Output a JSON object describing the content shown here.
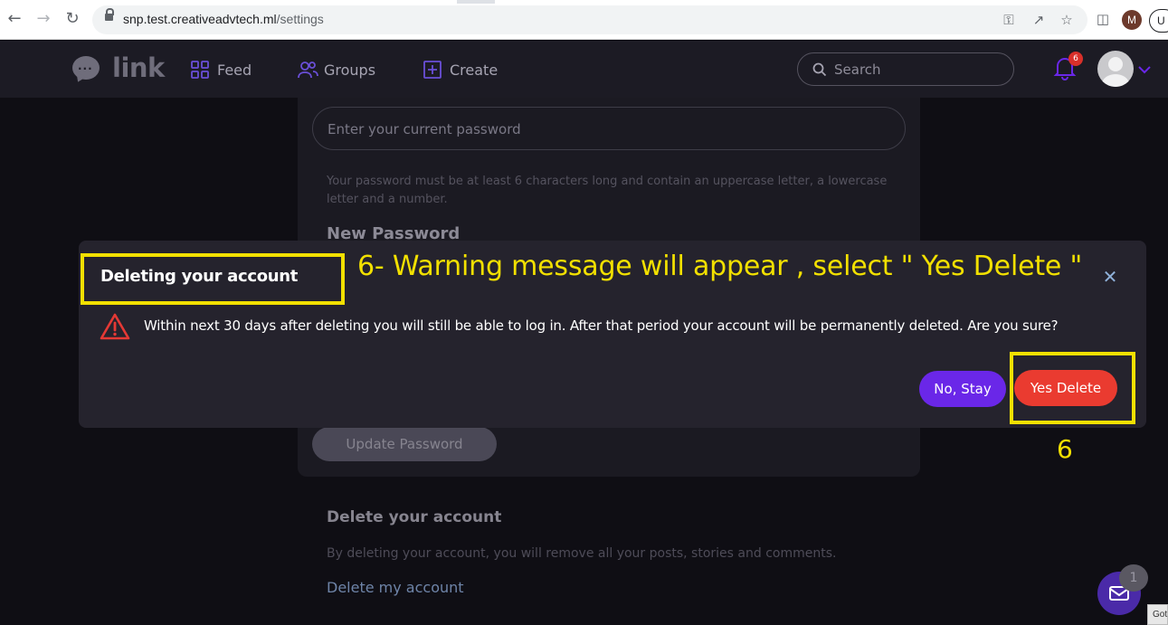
{
  "browser": {
    "url_host": "snp.test.creativeadvtech.ml",
    "url_path": "/settings",
    "profile_initial": "M",
    "update_label": "U"
  },
  "header": {
    "logo_text": "link",
    "nav": [
      {
        "label": "Feed",
        "icon": "grid-icon"
      },
      {
        "label": "Groups",
        "icon": "users-icon"
      },
      {
        "label": "Create",
        "icon": "plus-square-icon"
      }
    ],
    "search_placeholder": "Search",
    "notification_count": "6",
    "accent_color": "#6a27e8"
  },
  "settings": {
    "current_password_placeholder": "Enter your current password",
    "password_hint": "Your password must be at least 6 characters long and contain an uppercase letter, a lowercase letter and a number.",
    "new_password_label": "New Password",
    "update_button": "Update Password",
    "delete_title": "Delete your account",
    "delete_description": "By deleting your account, you will remove all your posts, stories and comments.",
    "delete_link": "Delete my account"
  },
  "modal": {
    "title": "Deleting your account",
    "message": "Within next 30 days after deleting you will still be able to log in. After that period your account will be permanently deleted. Are you sure?",
    "cancel_label": "No, Stay",
    "confirm_label": "Yes Delete",
    "confirm_color": "#ea3b30",
    "warning_color": "#e53935"
  },
  "annotation": {
    "caption": "6- Warning message will appear , select \" Yes Delete \"",
    "step": "6",
    "highlight_color": "#f2e000"
  },
  "chat": {
    "unread": "1"
  },
  "corner_tab": "Got"
}
